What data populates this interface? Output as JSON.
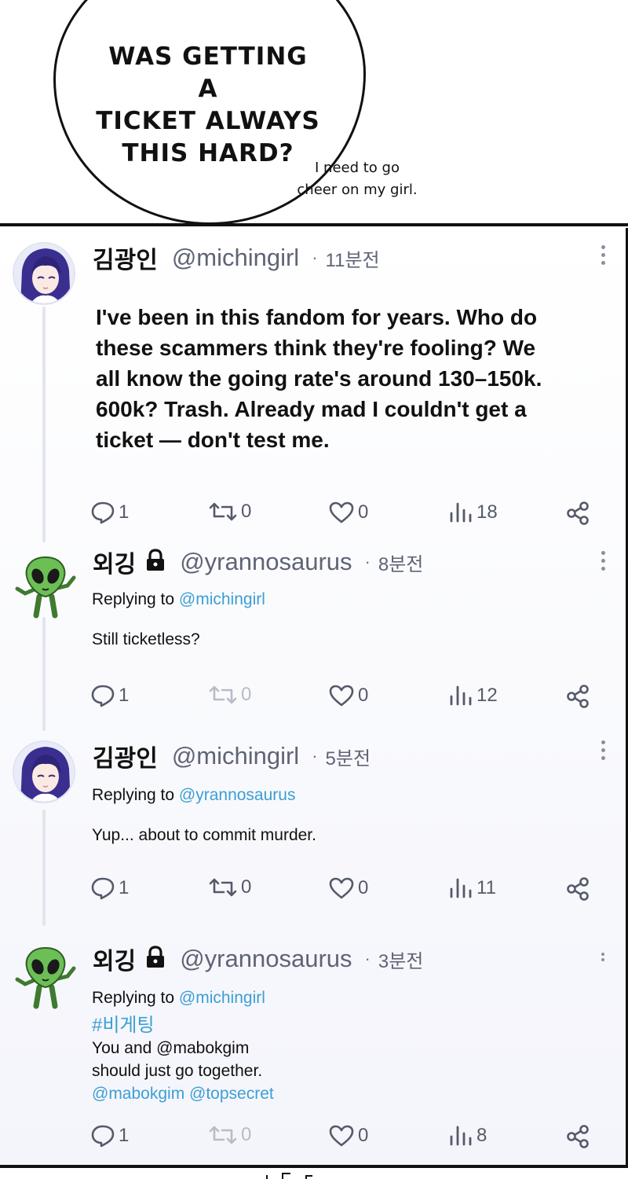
{
  "panel": {
    "speech_bubble": "WAS GETTING A TICKET ALWAYS THIS HARD?",
    "speech_lines": [
      "WAS GETTING A",
      "TICKET ALWAYS",
      "THIS HARD?"
    ],
    "aside_lines": [
      "I need to go",
      "cheer on my girl."
    ]
  },
  "tweets": [
    {
      "name": "김광인",
      "handle": "@michingirl",
      "time": "11분전",
      "locked": false,
      "avatar": "girl-avatar",
      "reply_label": "",
      "reply_to": "",
      "body_lines": [
        "I've been in this fandom for years. Who do",
        "these scammers think they're fooling? We",
        "all know the going rate's around 130–150k.",
        "600k? Trash. Already mad I couldn't get a",
        "ticket — don't test me."
      ],
      "stats": {
        "replies": "1",
        "retweets": "0",
        "likes": "0",
        "views": "18"
      }
    },
    {
      "name": "외깅",
      "handle": "@yrannosaurus",
      "time": "8분전",
      "locked": true,
      "avatar": "alien-avatar",
      "reply_label": "Replying to",
      "reply_to": "@michingirl",
      "body_lines": [
        "Still ticketless?"
      ],
      "stats": {
        "replies": "1",
        "retweets": "0",
        "likes": "0",
        "views": "12"
      }
    },
    {
      "name": "김광인",
      "handle": "@michingirl",
      "time": "5분전",
      "locked": false,
      "avatar": "girl-avatar",
      "reply_label": "Replying to",
      "reply_to": "@yrannosaurus",
      "body_lines": [
        "Yup... about to commit murder."
      ],
      "stats": {
        "replies": "1",
        "retweets": "0",
        "likes": "0",
        "views": "11"
      }
    },
    {
      "name": "외깅",
      "handle": "@yrannosaurus",
      "time": "3분전",
      "locked": true,
      "avatar": "alien-avatar",
      "reply_label": "Replying to",
      "reply_to": "@michingirl",
      "hashtag": "#비게팅",
      "body_lines": [
        "You and @mabokgim",
        "should just go together."
      ],
      "mentions": "@mabokgim @topsecret",
      "stats": {
        "replies": "1",
        "retweets": "0",
        "likes": "0",
        "views": "8"
      }
    }
  ],
  "colors": {
    "link": "#3c9fd4",
    "text": "#111111",
    "muted": "#5f6475",
    "retweet_inactive": "#b8bcc8"
  },
  "icons": [
    "reply-icon",
    "retweet-icon",
    "like-icon",
    "views-icon",
    "share-icon",
    "more-options-icon",
    "lock-icon"
  ]
}
